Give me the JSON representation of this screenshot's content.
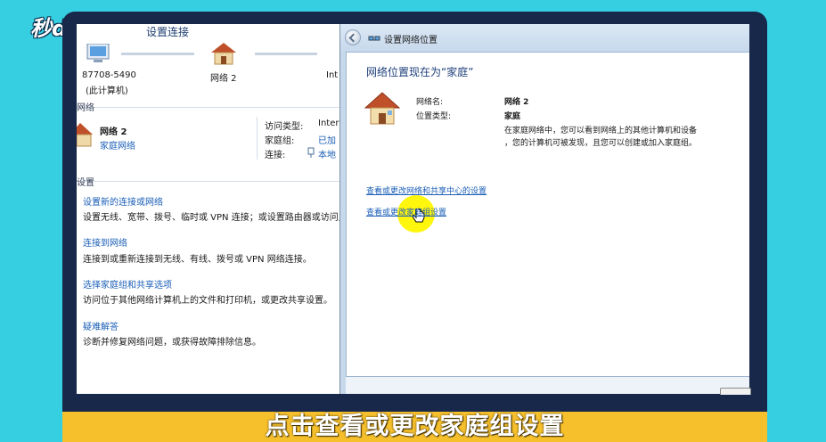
{
  "watermark": {
    "logo_text": "秒dong视频"
  },
  "caption": {
    "text": "点击查看或更改家庭组设置"
  },
  "colors": {
    "background": "#36cfe2",
    "caption_bar": "#f6c02d",
    "link": "#1b5fb7",
    "highlight": "#fff600"
  },
  "network_center": {
    "title_partial": "设置连接",
    "computer_name": "87708-5490",
    "computer_note": "(此计算机)",
    "network_map_label": "网络 2",
    "internet_label_partial": "Int",
    "active_networks_heading_partial": "网络",
    "network_name": "网络 2",
    "network_type": "家庭网络",
    "access_type_label": "访问类型:",
    "access_type_value_partial": "Inter",
    "homegroup_label": "家庭组:",
    "homegroup_value_partial": "已加",
    "connection_label": "连接:",
    "connection_value_partial": "本地",
    "settings_heading_partial": "设置",
    "tasks": [
      {
        "link": "设置新的连接或网络",
        "desc": "设置无线、宽带、拨号、临时或 VPN 连接；或设置路由器或访问点。"
      },
      {
        "link": "连接到网络",
        "desc": "连接到或重新连接到无线、有线、拨号或 VPN 网络连接。"
      },
      {
        "link": "选择家庭组和共享选项",
        "desc": "访问位于其他网络计算机上的文件和打印机，或更改共享设置。"
      },
      {
        "link": "疑难解答",
        "desc": "诊断并修复网络问题，或获得故障排除信息。"
      }
    ]
  },
  "dialog": {
    "window_title": "设置网络位置",
    "heading": "网络位置现在为“家庭”",
    "name_label": "网络名:",
    "name_value": "网络 2",
    "type_label": "位置类型:",
    "type_value": "家庭",
    "description_line1": "在家庭网络中，您可以看到网络上的其他计算机和设备",
    "description_line2": "，您的计算机可被发现，且您可以创建或加入家庭组。",
    "link_sharing_center": "查看或更改网络和共享中心的设置",
    "link_homegroup": "查看或更改家庭组设置",
    "footer_button_partial": ""
  }
}
